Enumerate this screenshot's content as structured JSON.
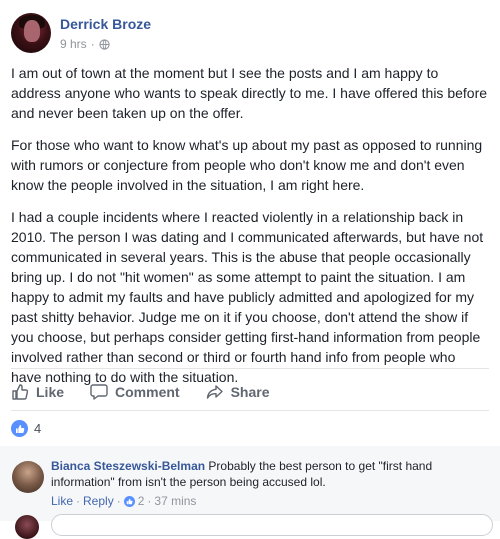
{
  "post": {
    "author": "Derrick Broze",
    "time": "9 hrs",
    "separator": "·",
    "privacy_icon": "globe-icon",
    "paragraphs": [
      "I am out of town at the moment but I see the posts and I am happy to address anyone who wants to speak directly to me. I have offered this before and never been taken up on the offer.",
      "For those who want to know what's up about my past as opposed to running with rumors or conjecture from people who don't know me and don't even know the people involved in the situation, I am right here.",
      "I had a couple incidents where I reacted violently in a relationship back in 2010. The person I was dating and I communicated afterwards, but have not communicated in several years. This is the abuse that people occasionally bring up. I do not \"hit women\" as some attempt to paint the situation. I am happy to admit my faults and have publicly admitted and apologized for my past shitty behavior. Judge me on it if you choose, don't attend the show if you choose, but perhaps consider getting first-hand information from people involved rather than second or third or fourth hand info from people who have nothing to do with the situation."
    ]
  },
  "actions": {
    "like": "Like",
    "comment": "Comment",
    "share": "Share"
  },
  "reactions": {
    "count": "4",
    "icon": "thumbs-up-icon"
  },
  "comment": {
    "author": "Bianca Steszewski-Belman",
    "text": "Probably the best person to get \"first hand information\" from isn't the person being accused lol.",
    "like": "Like",
    "reply": "Reply",
    "dot": "·",
    "likes": "2",
    "time": "37 mins"
  },
  "colors": {
    "link": "#365899",
    "accent": "#5890ff",
    "muted": "#90949c"
  }
}
